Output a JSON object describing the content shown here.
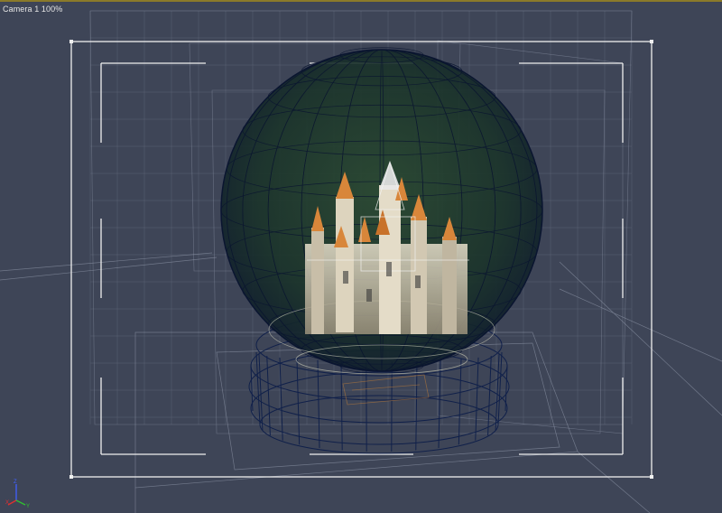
{
  "viewport": {
    "label": "Camera 1 100%",
    "camera_name": "Camera 1",
    "zoom": "100%"
  },
  "scene": {
    "objects": [
      "snow-globe-sphere",
      "globe-base",
      "castle-model",
      "background-planes",
      "ground-grid"
    ]
  },
  "gizmo": {
    "axis_x": "X",
    "axis_y": "Y",
    "axis_z": "Z"
  },
  "colors": {
    "background": "#3e4557",
    "grid_line": "#8b93a6",
    "frame_white": "#f0f0f0",
    "globe_wire": "#0d1a3a",
    "globe_fill": "#1e3a28",
    "castle_stone": "#cfc6b2",
    "castle_roof": "#d8863a",
    "axis_x": "#e03030",
    "axis_y": "#30c030",
    "axis_z": "#4060ff"
  }
}
